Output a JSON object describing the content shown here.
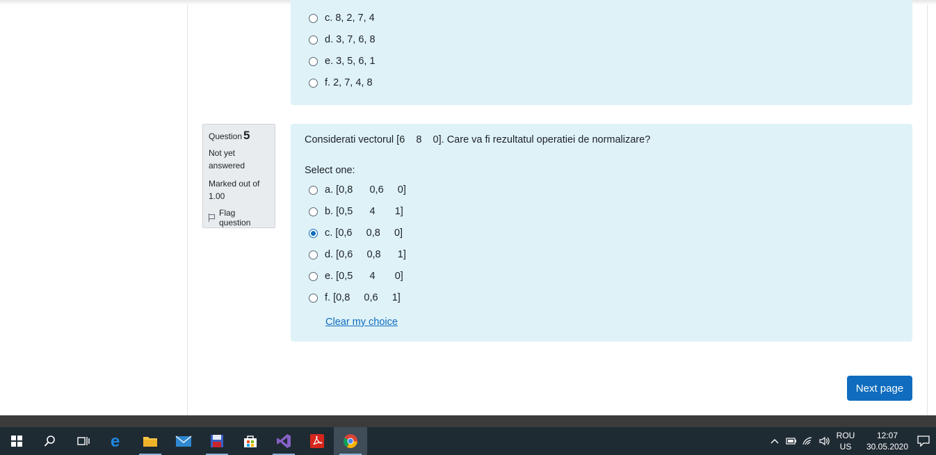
{
  "prev_question": {
    "options": [
      {
        "letter": "c.",
        "text": "8, 2, 7, 4"
      },
      {
        "letter": "d.",
        "text": "3, 7, 6, 8"
      },
      {
        "letter": "e.",
        "text": "3, 5, 6, 1"
      },
      {
        "letter": "f.",
        "text": "2, 7, 4, 8"
      }
    ]
  },
  "question5": {
    "info": {
      "label": "Question",
      "number": "5",
      "state_line1": "Not yet",
      "state_line2": "answered",
      "marked_line1": "Marked out of",
      "marked_line2": "1.00",
      "flag_label": "Flag question"
    },
    "text": "Considerati vectorul [6    8    0]. Care va fi rezultatul operatiei de normalizare?",
    "select_one": "Select one:",
    "options": [
      {
        "letter": "a.",
        "text": "[0,8      0,6     0]",
        "checked": false
      },
      {
        "letter": "b.",
        "text": "[0,5      4       1]",
        "checked": false
      },
      {
        "letter": "c.",
        "text": "[0,6     0,8     0]",
        "checked": true
      },
      {
        "letter": "d.",
        "text": "[0,6     0,8      1]",
        "checked": false
      },
      {
        "letter": "e.",
        "text": "[0,5      4       0]",
        "checked": false
      },
      {
        "letter": "f.",
        "text": "[0,8     0,6     1]",
        "checked": false
      }
    ],
    "clear_label": "Clear my choice"
  },
  "navigation": {
    "next_label": "Next page"
  },
  "taskbar": {
    "apps": [
      {
        "icon": "windows-start-icon"
      },
      {
        "icon": "search-icon"
      },
      {
        "icon": "task-view-icon"
      },
      {
        "icon": "edge-icon"
      },
      {
        "icon": "file-explorer-icon"
      },
      {
        "icon": "mail-icon"
      },
      {
        "icon": "save-disk-icon"
      },
      {
        "icon": "store-icon"
      },
      {
        "icon": "visual-studio-icon"
      },
      {
        "icon": "acrobat-icon"
      },
      {
        "icon": "chrome-icon"
      }
    ],
    "lang_line1": "ROU",
    "lang_line2": "US",
    "time": "12:07",
    "date": "30.05.2020"
  },
  "colors": {
    "question_bg": "#def2f8",
    "accent": "#0f6cbf",
    "taskbar_bg": "#1f2b33"
  }
}
